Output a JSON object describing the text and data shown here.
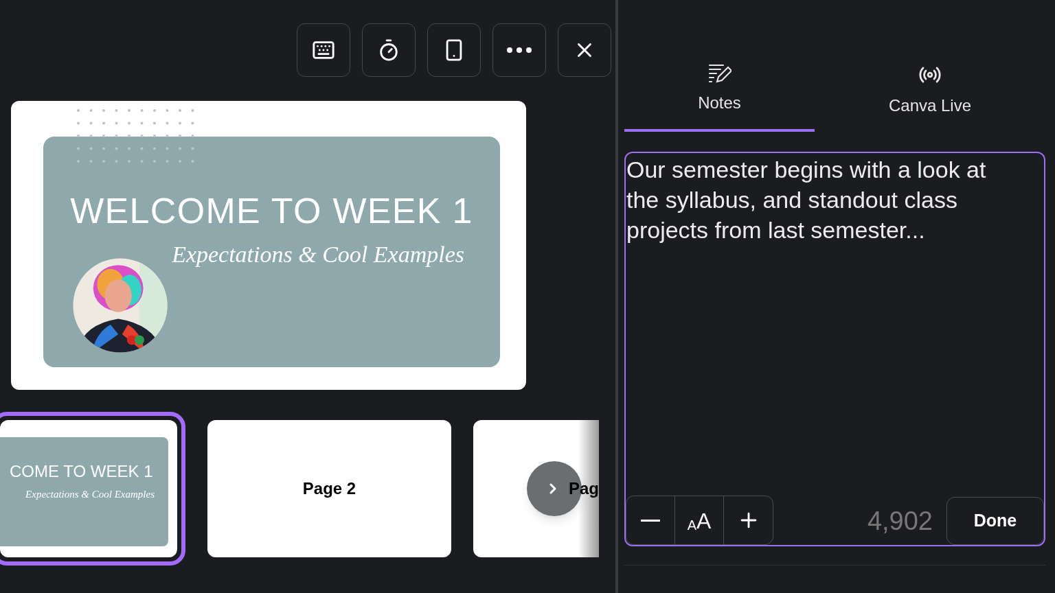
{
  "slide": {
    "title": "WELCOME TO WEEK 1",
    "subtitle": "Expectations & Cool Examples"
  },
  "thumbnails": [
    {
      "kind": "slide",
      "title": "COME TO WEEK 1",
      "subtitle": "Expectations & Cool Examples",
      "selected": true
    },
    {
      "kind": "blank",
      "label": "Page 2",
      "selected": false
    },
    {
      "kind": "blank",
      "label": "Pag",
      "selected": false
    }
  ],
  "tabs": [
    {
      "label": "Notes",
      "selected": true
    },
    {
      "label": "Canva Live",
      "selected": false
    }
  ],
  "notes": {
    "text": "Our semester begins with a look at the syllabus, and standout class projects from last semester...",
    "font_size_button": {
      "small": "A",
      "large": "A"
    },
    "count": "4,902",
    "done_button": "Done"
  }
}
